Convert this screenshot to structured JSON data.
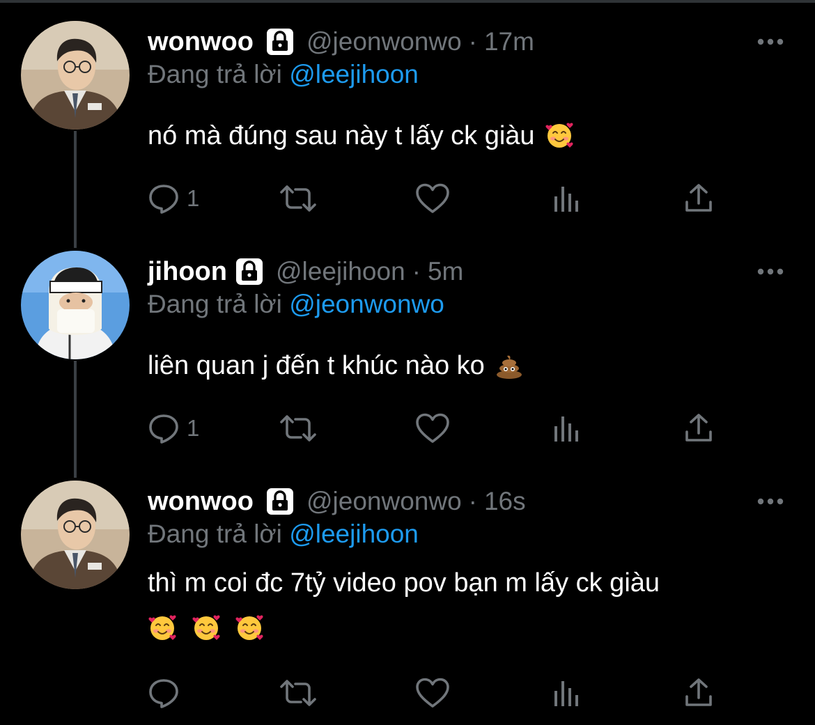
{
  "colors": {
    "background": "#000000",
    "primary_text": "#ffffff",
    "secondary_text": "#71767b",
    "mention": "#1d9bf0",
    "thread_line": "#3a3f44"
  },
  "tweets": [
    {
      "display_name": "wonwoo",
      "handle": "@jeonwonwo",
      "separator": "·",
      "time": "17m",
      "reply_prefix": "Đang trả lời",
      "reply_to": "@leejihoon",
      "text": "nó mà đúng sau này t lấy ck giàu",
      "emojis": [
        "smiling-face-with-hearts"
      ],
      "reply_count": "1",
      "avatar": "wonwoo-avatar",
      "icons": [
        "lock-icon",
        "more-icon",
        "reply-icon",
        "retweet-icon",
        "like-icon",
        "views-icon",
        "share-icon"
      ]
    },
    {
      "display_name": "jihoon",
      "handle": "@leejihoon",
      "separator": "·",
      "time": "5m",
      "reply_prefix": "Đang trả lời",
      "reply_to": "@jeonwonwo",
      "text": "liên quan j đến t khúc nào ko",
      "emojis": [
        "pile-of-poo"
      ],
      "reply_count": "1",
      "avatar": "jihoon-avatar",
      "icons": [
        "lock-icon",
        "more-icon",
        "reply-icon",
        "retweet-icon",
        "like-icon",
        "views-icon",
        "share-icon"
      ]
    },
    {
      "display_name": "wonwoo",
      "handle": "@jeonwonwo",
      "separator": "·",
      "time": "16s",
      "reply_prefix": "Đang trả lời",
      "reply_to": "@leejihoon",
      "text": "thì m coi đc 7tỷ video pov bạn m lấy ck giàu",
      "emojis": [
        "smiling-face-with-hearts",
        "smiling-face-with-hearts",
        "smiling-face-with-hearts"
      ],
      "reply_count": "",
      "avatar": "wonwoo-avatar",
      "icons": [
        "lock-icon",
        "more-icon",
        "reply-icon",
        "retweet-icon",
        "like-icon",
        "views-icon",
        "share-icon"
      ]
    }
  ]
}
